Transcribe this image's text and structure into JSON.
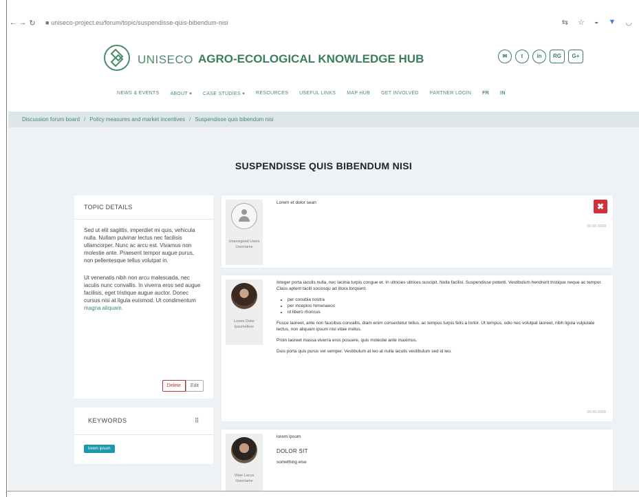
{
  "browser": {
    "back": "←",
    "forward": "→",
    "reload": "↻",
    "url": "■ uniseco-project.eu/forum/topic/suspendisse-quis-bibendum-nisi"
  },
  "header": {
    "brand": "UNISECO",
    "hub_title": "AGRO-ECOLOGICAL KNOWLEDGE HUB",
    "social": [
      "✉",
      "t",
      "in",
      "RG",
      "G+"
    ],
    "nav": [
      "NEWS & EVENTS",
      "ABOUT ▾",
      "CASE STUDIES ▾",
      "RESOURCES",
      "USEFUL LINKS",
      "MAP HUB",
      "GET INVOLVED",
      "PARTNER LOGIN",
      "FR",
      "IN"
    ]
  },
  "breadcrumb": [
    "Discussion forum board",
    "Policy measures and market incentives",
    "Suspendisse quis bibendum nisi"
  ],
  "page_title": "SUSPENDISSE QUIS BIBENDUM NISI",
  "topic": {
    "heading": "TOPIC DETAILS",
    "para1": "Sed ut elit sagittis, imperdiet mi quis, vehicula nulla. Nullam pulvinar lectus nec facilisis ullamcorper. Nunc ac arcu est. Vivamus non molestie ante. Praesent tempor augue purus, non pellentesque tellus volutpat in.",
    "para2": "Ut venenatis nibh non arcu malesuada, nec iaculis nunc convallis. In viverra eros sed augue facilisis, eget tristique augue auctor. Donec cursus nisi at ligula euismod. Ut condimentum",
    "para2_link": "magna aliquam.",
    "delete_label": "Delete",
    "edit_label": "Edit"
  },
  "keywords": {
    "heading": "KEYWORDS",
    "toggle": "⠿",
    "badge": "lorem ipsum"
  },
  "posts": [
    {
      "author": "Unassigned Users Username",
      "text": "Lorem et dolor sean",
      "date": "00.00.0000",
      "delete": "✖"
    },
    {
      "author": "Lorem Dolor Ipsumeliner",
      "p1": "Integer porta iaculis nulla, nec lacinia turpis congue et. In ultricies ultrices suscipit. Nulla facilisi. Suspendisse potenti. Vestibulum hendrerit tristique neque ac tempor.",
      "p1b": "Class aptent taciti sociosqu ad litora torquent.",
      "list": [
        "per conubia nostra",
        "per inceptos himenaeos",
        "id libero rhoncus"
      ],
      "p2": "Fusce laoreet, ante non faucibus convallis, diam enim consectetur tellus, ac tempus turpis felis a tortor. Ut tempus, odio nec volutpat laoreet, nibh ligula vulputate lectus, non aliquam ipsum nisl vitae metus.",
      "p3": "Proin laoreet massa viverra eros posuere, quis molestie ante maximus.",
      "p4": "Duis porta quis purus vel semper. Vestibulum at leo at nulla iaculis vestibulum sed id leo.",
      "date": "00.00.0000"
    },
    {
      "author": "Vitae Lacus Username",
      "p1": "lorem ipsum",
      "heading": "DOLOR SIT",
      "p2": "something else"
    }
  ]
}
